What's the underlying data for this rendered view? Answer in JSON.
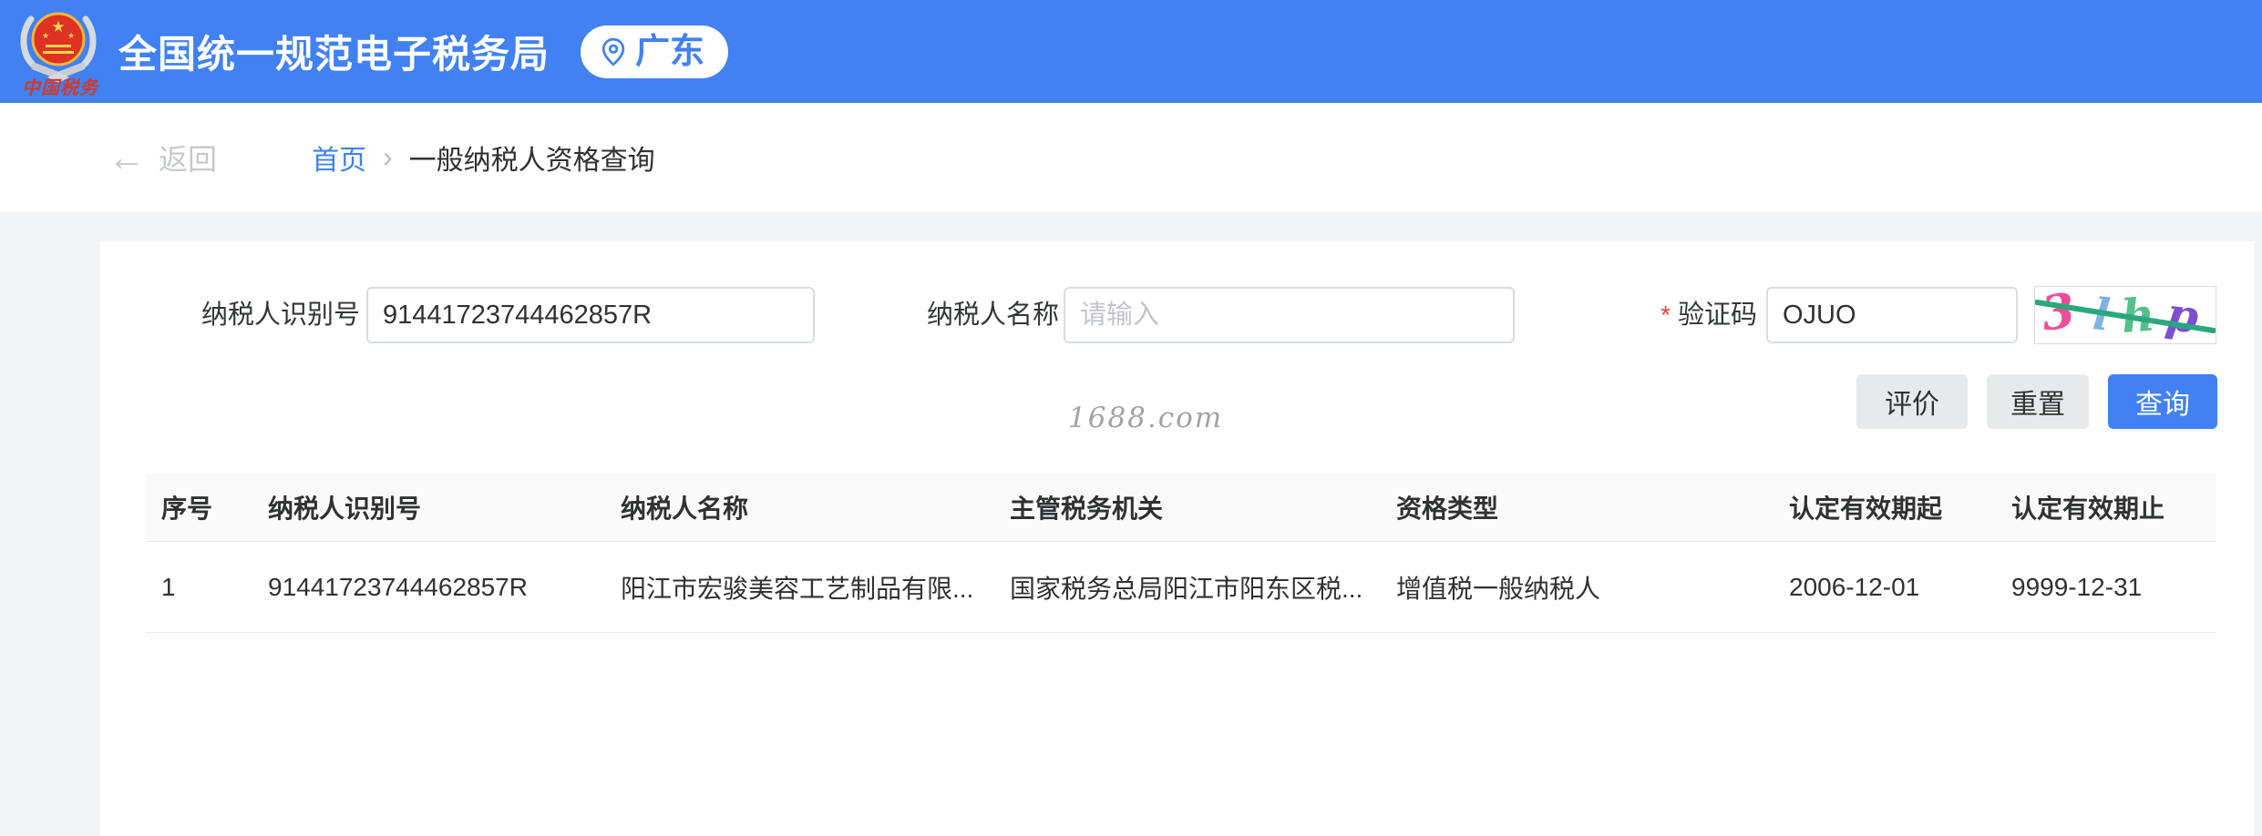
{
  "colors": {
    "accent_blue": "#4181f2",
    "header_bg": "#4181f2",
    "emblem_red": "#d9281e",
    "logo_caption_red": "#cf3a2b",
    "required_mark_red": "#e0403c",
    "captcha_line": "#2aa87c",
    "table_header_bg": "#fafafa"
  },
  "header": {
    "title": "全国统一规范电子税务局",
    "region": "广东",
    "logo_caption": "中国税务"
  },
  "breadcrumb": {
    "back": "返回",
    "back_arrow": "←",
    "home": "首页",
    "separator": "›",
    "current": "一般纳税人资格查询"
  },
  "form": {
    "taxpayer_id": {
      "label": "纳税人识别号",
      "value": "91441723744462857R"
    },
    "taxpayer_name": {
      "label": "纳税人名称",
      "placeholder": "请输入",
      "value": ""
    },
    "captcha": {
      "required_mark": "*",
      "label": "验证码",
      "value": "OJUO",
      "image_text": "3lhp",
      "chars": [
        {
          "char": "3",
          "color": "#ec4f9a"
        },
        {
          "char": "l",
          "color": "#7fb3e3"
        },
        {
          "char": "h",
          "color": "#56c08b"
        },
        {
          "char": "p",
          "color": "#7a4fd1"
        }
      ],
      "line_color": "#2aa87c"
    }
  },
  "watermark": "1688.com",
  "buttons": {
    "evaluate": "评价",
    "reset": "重置",
    "query": "查询"
  },
  "table": {
    "columns": [
      "序号",
      "纳税人识别号",
      "纳税人名称",
      "主管税务机关",
      "资格类型",
      "认定有效期起",
      "认定有效期止"
    ],
    "rows": [
      {
        "index": "1",
        "taxpayer_id": "91441723744462857R",
        "taxpayer_name": "阳江市宏骏美容工艺制品有限...",
        "tax_authority": "国家税务总局阳江市阳东区税...",
        "qualification_type": "增值税一般纳税人",
        "valid_from": "2006-12-01",
        "valid_to": "9999-12-31"
      }
    ]
  }
}
